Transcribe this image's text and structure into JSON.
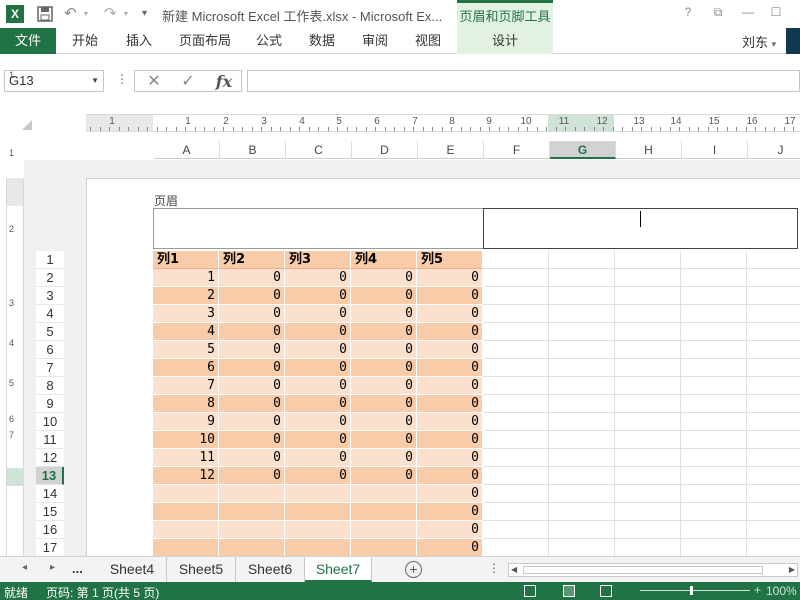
{
  "title_bar": {
    "app_icon": "excel-icon",
    "title": "新建 Microsoft Excel 工作表.xlsx - Microsoft Ex...",
    "contextual_group": "页眉和页脚工具",
    "help": "?",
    "ribbon_display": "⧉",
    "minimize": "—",
    "maximize": "☐"
  },
  "ribbon_tabs": {
    "file": "文件",
    "home": "开始",
    "insert": "插入",
    "page_layout": "页面布局",
    "formulas": "公式",
    "data": "数据",
    "review": "审阅",
    "view": "视图",
    "design": "设计",
    "user": "刘东",
    "user_dropdown": "▾"
  },
  "formula_bar": {
    "name_box": "G13",
    "cancel": "✕",
    "enter": "✓",
    "fx": "fx",
    "value": ""
  },
  "ruler": {
    "h_numbers": [
      "1",
      "1",
      "2",
      "3",
      "4",
      "5",
      "6",
      "7",
      "8",
      "9",
      "10",
      "11",
      "12",
      "13",
      "14",
      "15",
      "16",
      "17"
    ],
    "v_numbers": [
      "1",
      "1",
      "2",
      "3",
      "4",
      "5",
      "6",
      "7"
    ]
  },
  "columns": [
    "A",
    "B",
    "C",
    "D",
    "E",
    "F",
    "G",
    "H",
    "I",
    "J"
  ],
  "selected_column": "G",
  "header_label": "页眉",
  "rows": [
    "1",
    "2",
    "3",
    "4",
    "5",
    "6",
    "7",
    "8",
    "9",
    "10",
    "11",
    "12",
    "13",
    "14",
    "15",
    "16",
    "17"
  ],
  "selected_row": "13",
  "table": {
    "headers": [
      "列1",
      "列2",
      "列3",
      "列4",
      "列5"
    ],
    "data": [
      [
        "1",
        "0",
        "0",
        "0",
        "0"
      ],
      [
        "2",
        "0",
        "0",
        "0",
        "0"
      ],
      [
        "3",
        "0",
        "0",
        "0",
        "0"
      ],
      [
        "4",
        "0",
        "0",
        "0",
        "0"
      ],
      [
        "5",
        "0",
        "0",
        "0",
        "0"
      ],
      [
        "6",
        "0",
        "0",
        "0",
        "0"
      ],
      [
        "7",
        "0",
        "0",
        "0",
        "0"
      ],
      [
        "8",
        "0",
        "0",
        "0",
        "0"
      ],
      [
        "9",
        "0",
        "0",
        "0",
        "0"
      ],
      [
        "10",
        "0",
        "0",
        "0",
        "0"
      ],
      [
        "11",
        "0",
        "0",
        "0",
        "0"
      ],
      [
        "12",
        "0",
        "0",
        "0",
        "0"
      ],
      [
        "",
        "",
        "",
        "",
        "0"
      ],
      [
        "",
        "",
        "",
        "",
        "0"
      ],
      [
        "",
        "",
        "",
        "",
        "0"
      ],
      [
        "",
        "",
        "",
        "",
        "0"
      ]
    ],
    "band_colors": [
      "#fbe1cd",
      "#f8cba9"
    ]
  },
  "sheet_tabs": {
    "prev": "◂",
    "next": "▸",
    "more": "...",
    "tabs": [
      "Sheet4",
      "Sheet5",
      "Sheet6",
      "Sheet7"
    ],
    "active": "Sheet7",
    "add": "+",
    "options": "⋮"
  },
  "status_bar": {
    "ready": "就绪",
    "page_info": "页码: 第 1 页(共 5 页)",
    "zoom_plus": "+",
    "zoom": "100%"
  },
  "colors": {
    "accent": "#217346",
    "table_band_light": "#fbe1cd",
    "table_band_dark": "#f8cba9"
  }
}
